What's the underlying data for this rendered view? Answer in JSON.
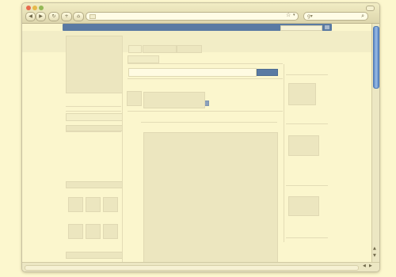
{
  "browser": {
    "toolbar": {
      "back_icon": "back-arrow-icon",
      "forward_icon": "forward-arrow-icon",
      "reload_icon": "reload-icon",
      "add_icon": "plus-icon",
      "home_icon": "home-icon",
      "back_glyph": "◀",
      "forward_glyph": "▶",
      "reload_glyph": "↻",
      "add_glyph": "+",
      "home_glyph": "⌂"
    },
    "address_bar": {
      "value": ""
    },
    "search_bar": {
      "provider_glyph": "g▾",
      "value": ""
    }
  },
  "page": {
    "site_search_value": "",
    "share_button_label": "",
    "more_button_label": ""
  },
  "colors": {
    "background": "#fcf7ce",
    "site_header": "#5a7aa3",
    "share_button": "#5a7aa3",
    "scrollbar_thumb": "#5a86c4"
  }
}
